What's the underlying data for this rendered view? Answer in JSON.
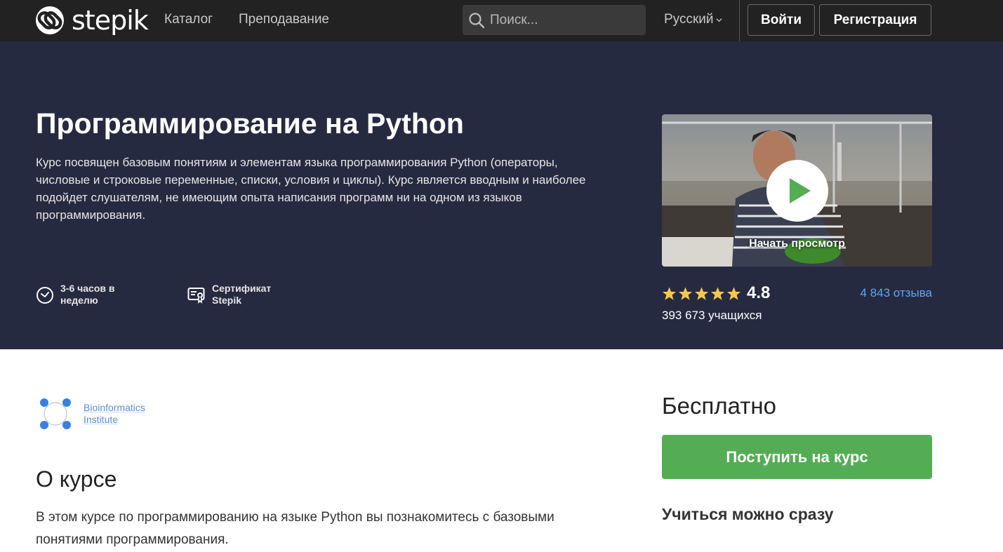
{
  "nav": {
    "logo_text": "stepik",
    "links": [
      "Каталог",
      "Преподавание"
    ],
    "search_placeholder": "Поиск...",
    "language": "Русский",
    "login": "Войти",
    "register": "Регистрация"
  },
  "hero": {
    "title": "Программирование на Python",
    "description": "Курс посвящен базовым понятиям и элементам языка программирования Python (операторы, числовые и строковые переменные, списки, условия и циклы). Курс является вводным и наиболее подойдет слушателям, не имеющим опыта написания программ ни на одном из языков программирования.",
    "meta": [
      {
        "icon": "clock-icon",
        "lines": [
          "3-6 часов в",
          "неделю"
        ]
      },
      {
        "icon": "certificate-icon",
        "lines": [
          "Сертификат",
          "Stepik"
        ]
      }
    ],
    "video_label": "Начать просмотр",
    "rating_value": "4.8",
    "stars": 5,
    "reviews": "4 843 отзыва",
    "learners": "393 673 учащихся"
  },
  "org": {
    "name_lines": [
      "Bioinformatics",
      "Institute"
    ]
  },
  "about": {
    "heading": "О курсе",
    "text": "В этом курсе по программированию на языке Python вы познакомитесь с базовыми понятиями программирования."
  },
  "sidebar": {
    "price": "Бесплатно",
    "enroll": "Поступить на курс",
    "learn_now": "Учиться можно сразу"
  },
  "colors": {
    "nav_bg": "#222222",
    "hero_bg": "#262a40",
    "accent_green": "#54ad54",
    "link_blue": "#5aa9f5",
    "star": "#f5c84c"
  }
}
